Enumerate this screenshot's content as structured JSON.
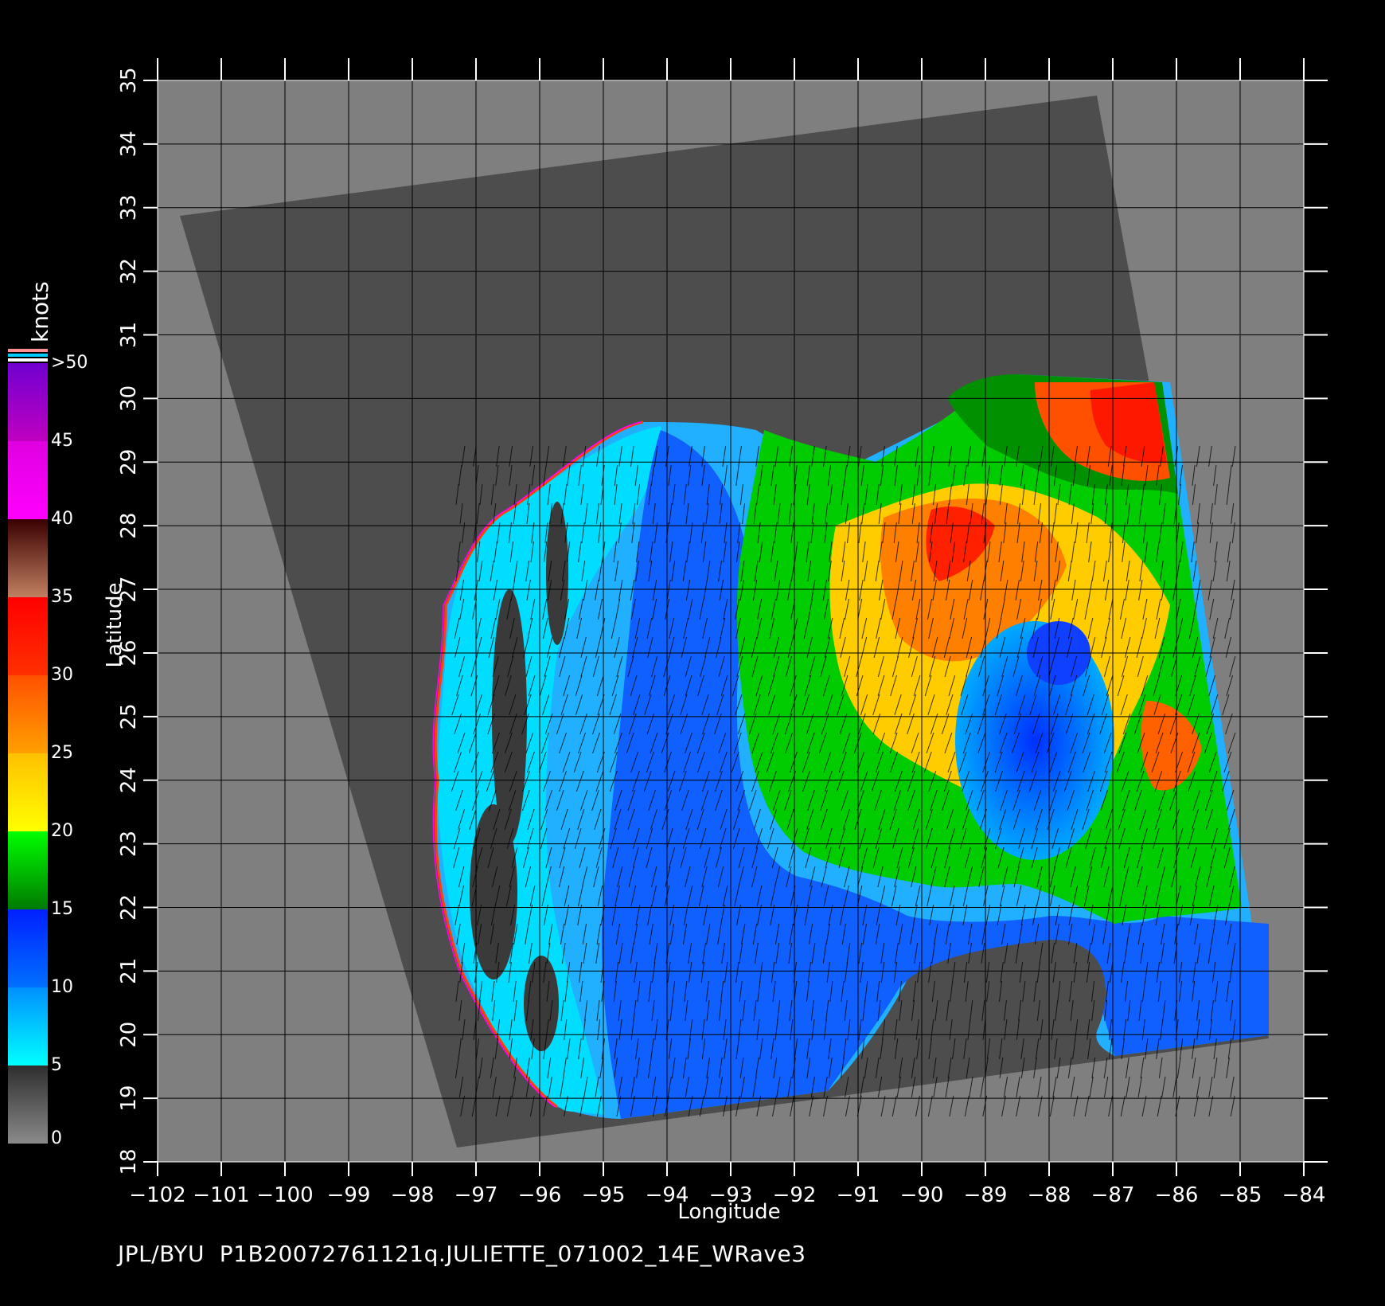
{
  "map": {
    "x_axis_label": "Longitude",
    "y_axis_label": "Latitude",
    "lon_ticks": [
      -102,
      -101,
      -100,
      -99,
      -98,
      -97,
      -96,
      -95,
      -94,
      -93,
      -92,
      -91,
      -90,
      -89,
      -88,
      -87,
      -86,
      -85,
      -84
    ],
    "lat_ticks": [
      18,
      19,
      20,
      21,
      22,
      23,
      24,
      25,
      26,
      27,
      28,
      29,
      30,
      31,
      32,
      33,
      34,
      35
    ],
    "lon_range": [
      -102,
      -84
    ],
    "lat_range": [
      18,
      35
    ],
    "grid": true
  },
  "colorbar": {
    "unit_label": "knots",
    "tick_labels": [
      "0",
      "5",
      "10",
      "15",
      "20",
      "25",
      "30",
      "35",
      "40",
      "45",
      ">50"
    ],
    "bands": [
      {
        "from": 0,
        "to": 5,
        "colors": [
          "#8a8a8a",
          "#2e2e2e"
        ]
      },
      {
        "from": 5,
        "to": 10,
        "colors": [
          "#00ffff",
          "#0090ff"
        ]
      },
      {
        "from": 10,
        "to": 15,
        "colors": [
          "#0070ff",
          "#0020ff"
        ]
      },
      {
        "from": 15,
        "to": 20,
        "colors": [
          "#007a00",
          "#00ff00"
        ]
      },
      {
        "from": 20,
        "to": 25,
        "colors": [
          "#ffff00",
          "#ffc000"
        ]
      },
      {
        "from": 25,
        "to": 30,
        "colors": [
          "#ffa000",
          "#ff5000"
        ]
      },
      {
        "from": 30,
        "to": 35,
        "colors": [
          "#ff3000",
          "#ff0000"
        ]
      },
      {
        "from": 35,
        "to": 40,
        "colors": [
          "#c08060",
          "#3a0000"
        ]
      },
      {
        "from": 40,
        "to": 45,
        "colors": [
          "#ff00ff",
          "#e000e0"
        ]
      },
      {
        "from": 45,
        "to": 50,
        "colors": [
          "#c000c0",
          "#7000d0"
        ]
      }
    ]
  },
  "colors": {
    "background": "#000000",
    "plot_background": "#7f7f7f",
    "swath": "#4d4d4d",
    "land": "#4d4d4d"
  },
  "footer": {
    "caption": "JPL/BYU  P1B20072761121q.JULIETTE_071002_14E_WRave3"
  }
}
